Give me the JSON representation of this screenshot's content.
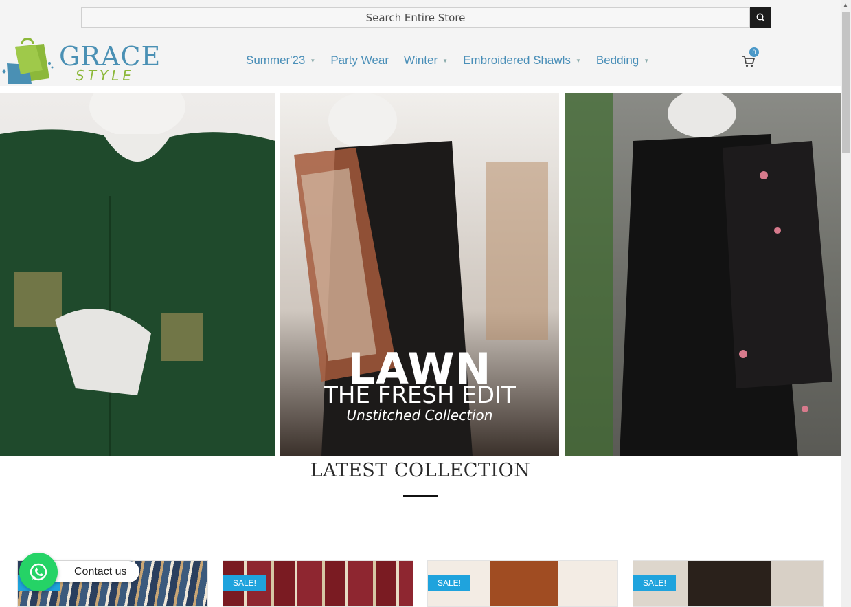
{
  "search": {
    "placeholder": "Search Entire Store"
  },
  "logo": {
    "line1": "GRACE",
    "line2": "STYLE"
  },
  "nav": {
    "items": [
      {
        "label": "Summer'23",
        "has_dropdown": true
      },
      {
        "label": "Party Wear",
        "has_dropdown": false
      },
      {
        "label": "Winter",
        "has_dropdown": true
      },
      {
        "label": "Embroidered Shawls",
        "has_dropdown": true
      },
      {
        "label": "Bedding",
        "has_dropdown": true
      }
    ]
  },
  "cart": {
    "count": "0",
    "icon": "cart-icon"
  },
  "banner": {
    "headline": "LAWN",
    "subheadline": "THE FRESH EDIT",
    "tagline": "Unstitched Collection"
  },
  "section": {
    "title": "LATEST COLLECTION"
  },
  "products": [
    {
      "badge": "SALE!"
    },
    {
      "badge": "SALE!"
    },
    {
      "badge": "SALE!"
    },
    {
      "badge": "SALE!"
    }
  ],
  "whatsapp": {
    "label": "Contact us",
    "icon": "whatsapp-icon"
  },
  "colors": {
    "brand_blue": "#4a90b4",
    "brand_green": "#8cb83a",
    "sale_blue": "#1fa3dd",
    "whatsapp_green": "#25d366"
  }
}
